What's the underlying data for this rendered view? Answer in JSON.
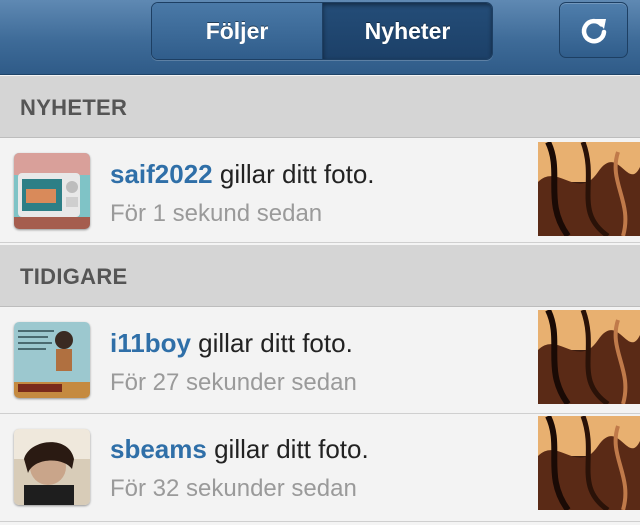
{
  "tabs": {
    "following": "Följer",
    "news": "Nyheter"
  },
  "sections": {
    "news": "NYHETER",
    "earlier": "TIDIGARE"
  },
  "notifications": [
    {
      "user": "saif2022",
      "action": "gillar ditt foto.",
      "time": "För 1 sekund sedan"
    },
    {
      "user": "i11boy",
      "action": "gillar ditt foto.",
      "time": "För 27 sekunder sedan"
    },
    {
      "user": "sbeams",
      "action": "gillar ditt foto.",
      "time": "För 32 sekunder sedan"
    }
  ],
  "icons": {
    "refresh": "refresh-icon"
  },
  "colors": {
    "nav_bar": "#3e6b98",
    "username": "#2f6fa8",
    "section_bg": "#d5d5d5"
  }
}
